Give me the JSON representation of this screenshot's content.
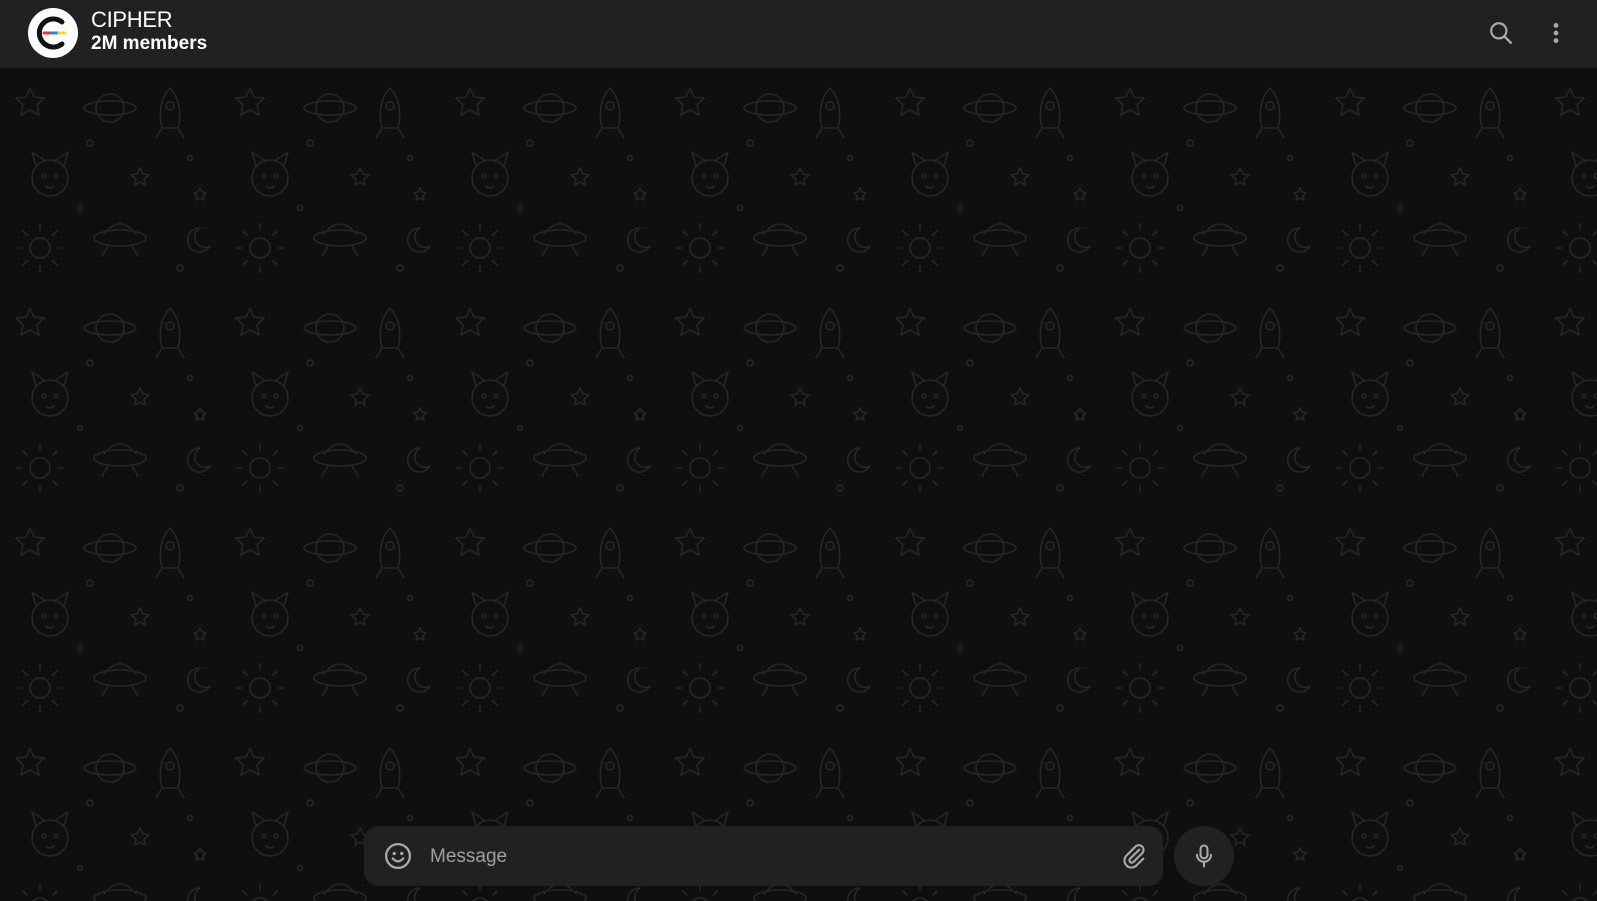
{
  "header": {
    "title": "CIPHER",
    "subtitle": "2M members",
    "avatar_icon": "cipher-logo",
    "search_icon": "search-icon",
    "more_icon": "more-vertical-icon"
  },
  "composer": {
    "placeholder": "Message",
    "emoji_icon": "smiley-icon",
    "attach_icon": "paperclip-icon",
    "mic_icon": "microphone-icon"
  },
  "colors": {
    "header_bg": "#212121",
    "chat_bg": "#0f0f0f",
    "composer_bg": "#212121",
    "text": "#ffffff",
    "icon": "#aaaaaa",
    "placeholder": "#a0a0a0"
  }
}
